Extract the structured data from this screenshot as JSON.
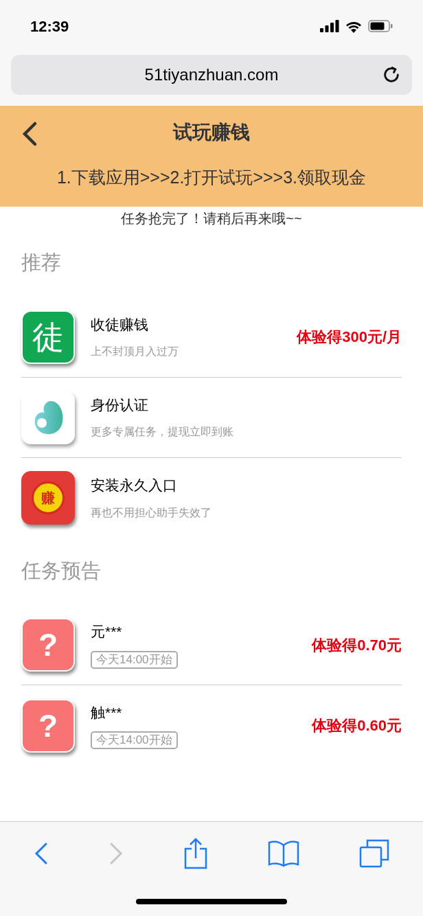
{
  "status_bar": {
    "time": "12:39"
  },
  "browser": {
    "url": "51tiyanzhuan.com"
  },
  "header": {
    "title": "试玩赚钱",
    "steps": "1.下载应用>>>2.打开试玩>>>3.领取现金"
  },
  "notice": "任务抢完了！请稍后再来哦~~",
  "sections": [
    {
      "title": "推荐",
      "items": [
        {
          "icon": {
            "kind": "glyph-green",
            "glyph": "徒"
          },
          "name": "收徒赚钱",
          "subtitle": "上不封顶月入过万",
          "reward": "体验得300元/月"
        },
        {
          "icon": {
            "kind": "droplet"
          },
          "name": "身份认证",
          "subtitle": "更多专属任务，提现立即到账"
        },
        {
          "icon": {
            "kind": "envelope",
            "glyph": "赚"
          },
          "name": "安装永久入口",
          "subtitle": "再也不用担心助手失效了"
        }
      ]
    },
    {
      "title": "任务预告",
      "items": [
        {
          "icon": {
            "kind": "unknown",
            "glyph": "?"
          },
          "name": "元***",
          "tag": "今天14:00开始",
          "reward": "体验得0.70元"
        },
        {
          "icon": {
            "kind": "unknown",
            "glyph": "?"
          },
          "name": "触***",
          "tag": "今天14:00开始",
          "reward": "体验得0.60元"
        }
      ]
    }
  ]
}
